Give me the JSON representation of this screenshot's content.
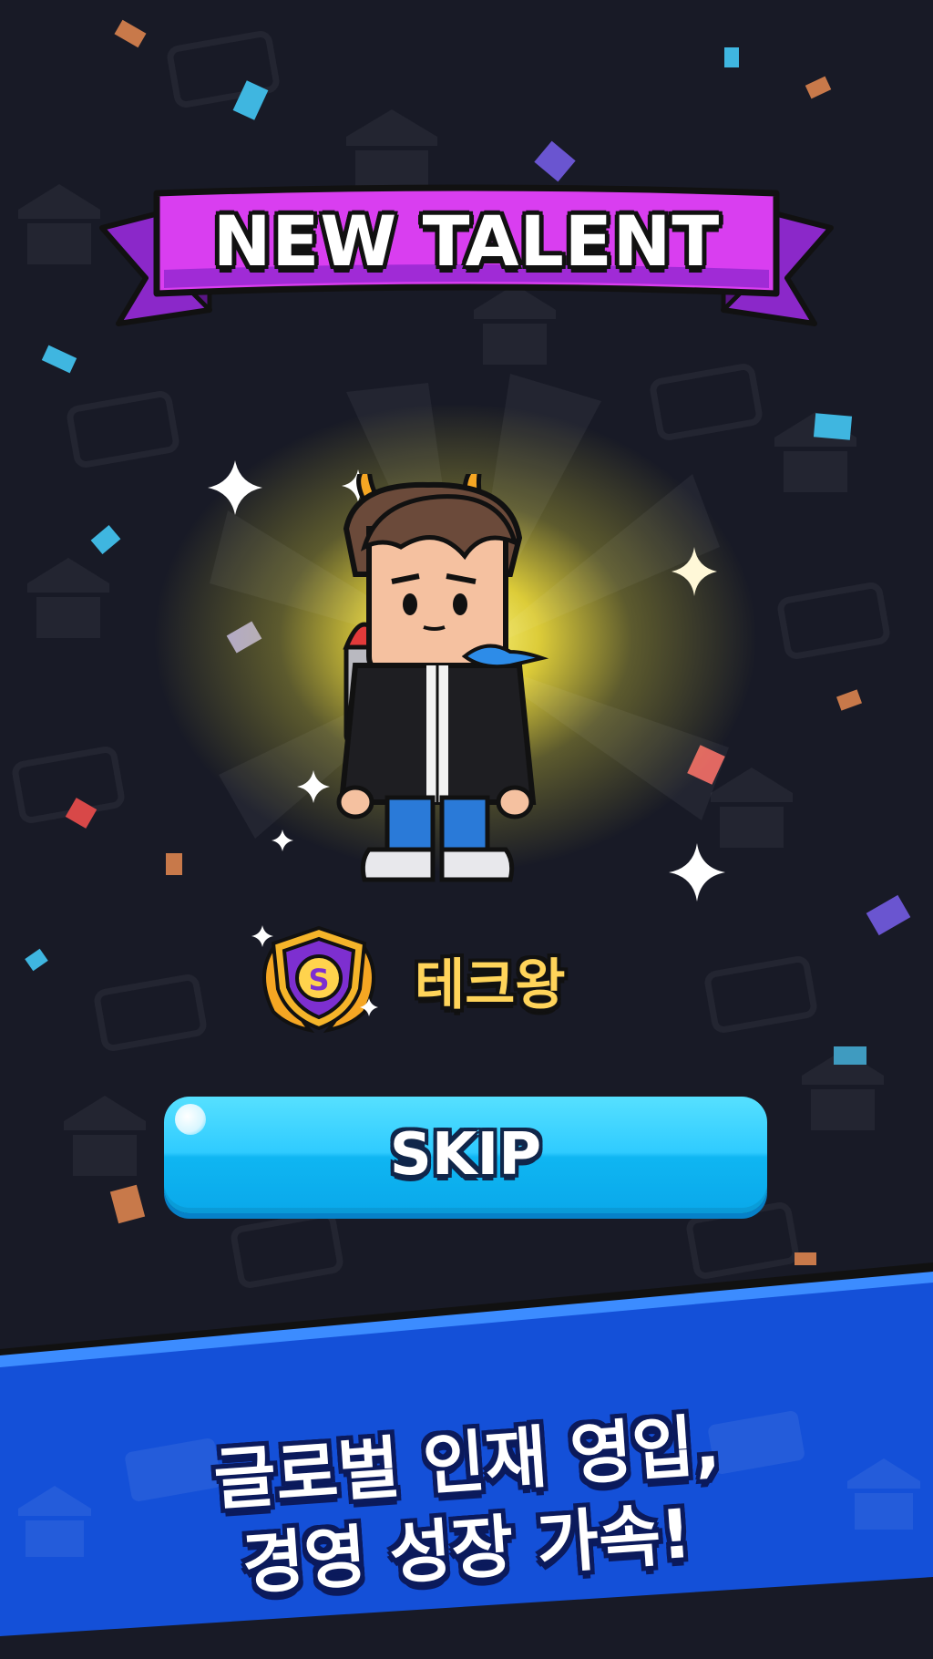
{
  "header": {
    "title": "NEW TALENT"
  },
  "talent": {
    "name": "테크왕",
    "badge_icon": "dollar-shield-laurel-icon"
  },
  "actions": {
    "skip_label": "SKIP"
  },
  "promo": {
    "line1": "글로벌 인재 영입,",
    "line2": "경영 성장 가속!"
  },
  "colors": {
    "background": "#181a26",
    "ribbon": "#d93ef0",
    "skip_button": "#2fcbff",
    "banner": "#1450d8",
    "talent_name": "#ffd45a"
  }
}
